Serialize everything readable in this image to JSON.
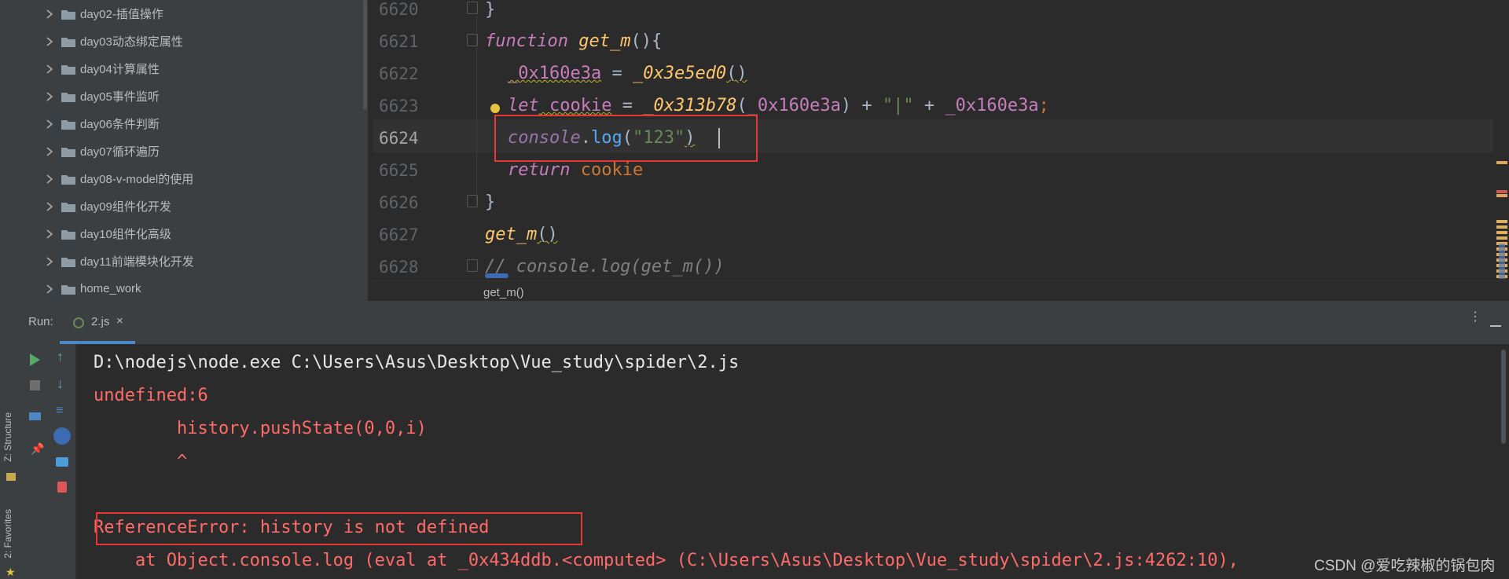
{
  "left_strip": {
    "structure_tab": "Z: Structure",
    "favorites_tab": "2: Favorites"
  },
  "project_tree": {
    "items": [
      {
        "label": "day02-插值操作"
      },
      {
        "label": "day03动态绑定属性"
      },
      {
        "label": "day04计算属性"
      },
      {
        "label": "day05事件监听"
      },
      {
        "label": "day06条件判断"
      },
      {
        "label": "day07循环遍历"
      },
      {
        "label": "day08-v-model的使用"
      },
      {
        "label": "day09组件化开发"
      },
      {
        "label": "day10组件化高级"
      },
      {
        "label": "day11前端模块化开发"
      },
      {
        "label": "home_work"
      }
    ]
  },
  "editor": {
    "line_numbers": [
      "6620",
      "6621",
      "6622",
      "6623",
      "6624",
      "6625",
      "6626",
      "6627",
      "6628"
    ],
    "lines": {
      "l6620": {
        "brace": "}"
      },
      "l6621": {
        "kw": "function",
        "name": " get_m",
        "rest": "(){"
      },
      "l6622": {
        "var": "_0x160e3a",
        "eq": " = ",
        "call": "_0x3e5ed0",
        "rest": "()"
      },
      "l6623": {
        "kw": "let",
        "var": " cookie",
        "eq": " = ",
        "call": "_0x313b78",
        "p1": "(",
        "a1": "_0x160e3a",
        "p2": ") + ",
        "s": "\"|\"",
        "p3": " + ",
        "a2": "_0x160e3a",
        "end": ";"
      },
      "l6624": {
        "obj": "console",
        "dot": ".",
        "meth": "log",
        "p1": "(",
        "s": "\"123\"",
        "p2": ")"
      },
      "l6625": {
        "kw": "return",
        "var": " cookie"
      },
      "l6626": {
        "brace": "}"
      },
      "l6627": {
        "call": "get_m",
        "rest": "()"
      },
      "l6628": {
        "comment": "// console.log(get_m())"
      }
    },
    "breadcrumb": "get_m()"
  },
  "run": {
    "label": "Run:",
    "tab_label": "2.js",
    "tab_close": "×",
    "output": {
      "cmd": "D:\\nodejs\\node.exe C:\\Users\\Asus\\Desktop\\Vue_study\\spider\\2.js",
      "l1": "undefined:6",
      "l2": "        history.pushState(0,0,i)",
      "l3": "        ^",
      "l4": "ReferenceError: history is not defined",
      "l5": "    at Object.console.log (eval at _0x434ddb.<computed> (C:\\Users\\Asus\\Desktop\\Vue_study\\spider\\2.js:4262:10),"
    },
    "watermark": "CSDN @爱吃辣椒的锅包肉"
  },
  "colors": {
    "highlight_box": "#e53935",
    "error_text": "#ff6b68",
    "tab_underline": "#4a88c7"
  }
}
